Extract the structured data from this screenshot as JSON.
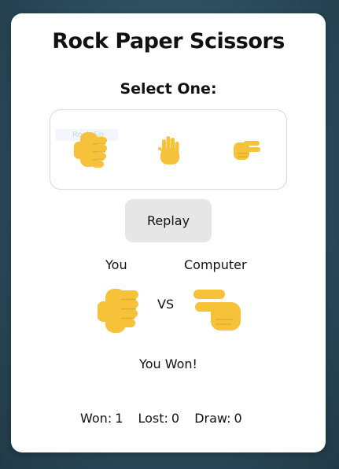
{
  "title": "Rock Paper Scissors",
  "subtitle": "Select One:",
  "choices": [
    {
      "name": "rock",
      "icon": "fist-icon"
    },
    {
      "name": "paper",
      "icon": "raised-hand-icon"
    },
    {
      "name": "scissors",
      "icon": "victory-hand-icon"
    }
  ],
  "hover_tooltip": "Rock Sp",
  "replay_label": "Replay",
  "players": {
    "you_label": "You",
    "computer_label": "Computer",
    "vs_label": "VS"
  },
  "picks": {
    "you": "rock",
    "computer": "scissors"
  },
  "result_text": "You Won!",
  "score": {
    "won_label": "Won:",
    "won": 1,
    "lost_label": "Lost:",
    "lost": 0,
    "draw_label": "Draw:",
    "draw": 0
  },
  "colors": {
    "hand": "#f5c23a",
    "hand_shade": "#e0a82a",
    "background": "#2b4a5a",
    "button": "#e6e6e6"
  }
}
